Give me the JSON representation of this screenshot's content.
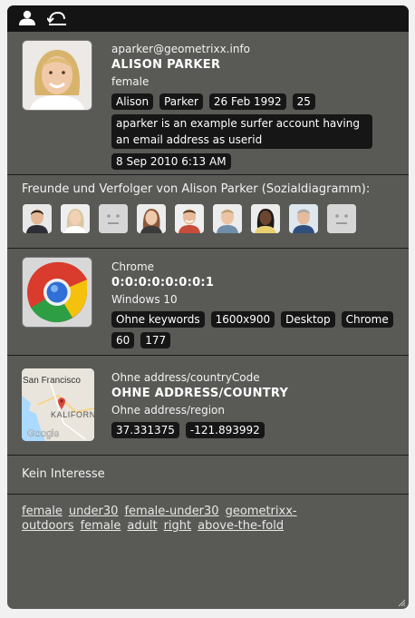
{
  "user": {
    "email": "aparker@geometrixx.info",
    "name": "ALISON PARKER",
    "gender": "female",
    "badges": [
      "Alison",
      "Parker",
      "26 Feb 1992",
      "25"
    ],
    "description": "aparker is an example surfer account having an email address as userid",
    "last_seen": "8 Sep 2010 6:13 AM"
  },
  "friends": {
    "title": "Freunde und Verfolger von Alison Parker (Sozialdiagramm):",
    "avatars": [
      "man-dark-hair",
      "woman-blonde",
      "placeholder",
      "woman-brown-hair",
      "man-smiling",
      "man-light-hair",
      "woman-dark-skin",
      "man-gray-hair",
      "placeholder"
    ]
  },
  "device": {
    "browser": "Chrome",
    "ip": "0:0:0:0:0:0:0:1",
    "os": "Windows 10",
    "badges": [
      "Ohne keywords",
      "1600x900",
      "Desktop",
      "Chrome",
      "60",
      "177"
    ]
  },
  "geo": {
    "country_code": "Ohne address/countryCode",
    "country": "OHNE ADDRESS/COUNTRY",
    "region": "Ohne address/region",
    "badges": [
      "37.331375",
      "-121.893992"
    ],
    "map_labels": {
      "city": "San Francisco",
      "state": "KALIFORN",
      "provider": "Google"
    }
  },
  "interest": "Kein Interesse",
  "tags": [
    "female",
    "under30",
    "female-under30",
    "geometrixx-outdoors",
    "female",
    "adult",
    "right",
    "above-the-fold"
  ],
  "colors": {
    "panel": "#595a56",
    "topbar": "#141414",
    "badge": "#161616",
    "page": "#f1f1f1"
  }
}
